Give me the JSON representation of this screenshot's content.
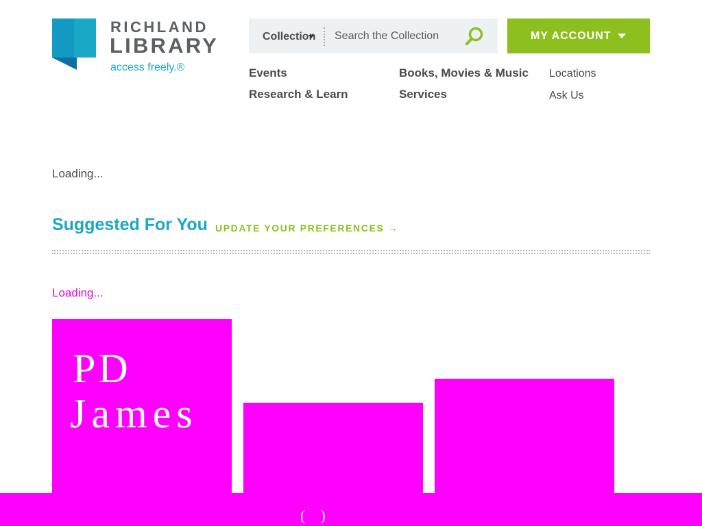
{
  "logo": {
    "line1": "RICHLAND",
    "line2": "LIBRARY",
    "tagline": "access freely.®",
    "colors": {
      "mark_dark": "#0e6fa3",
      "mark_light": "#1aa8c7",
      "text": "#5b5f66"
    }
  },
  "search": {
    "scope_label": "Collection",
    "placeholder": "Search the Collection",
    "button_icon": "magnifier-icon"
  },
  "account": {
    "label": "MY ACCOUNT",
    "icon": "caret-down-icon",
    "color": "#8dc01f"
  },
  "nav": {
    "primary": [
      "Events",
      "Books, Movies & Music",
      "Research & Learn",
      "Services"
    ],
    "secondary": [
      "Locations",
      "Ask Us"
    ]
  },
  "main": {
    "loading_text": "Loading...",
    "suggest_title": "Suggested For You",
    "suggest_link": "UPDATE YOUR PREFERENCES →",
    "suggest_loading": "Loading...",
    "covers": [
      {
        "text_line1": "PD",
        "text_line2": "James"
      },
      {},
      {}
    ]
  },
  "colors": {
    "accent_blue": "#1aa8c7",
    "accent_green": "#8dc01f",
    "placeholder_magenta": "#ff00ff"
  }
}
